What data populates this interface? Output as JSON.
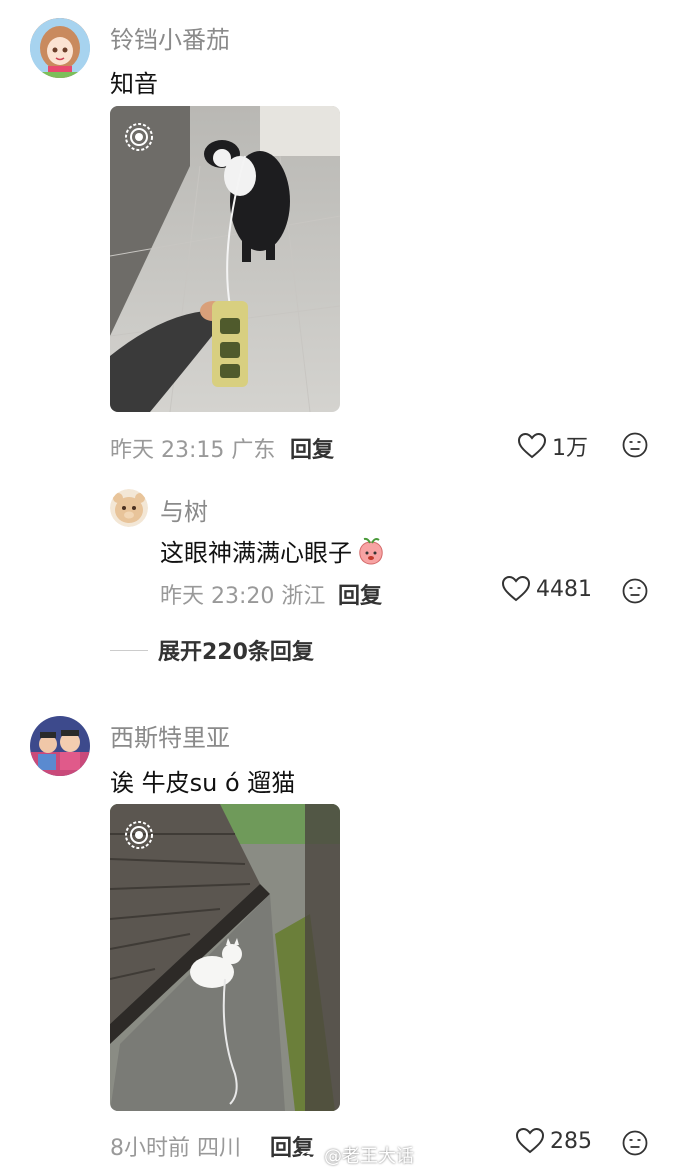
{
  "comments": [
    {
      "username": "铃铛小番茄",
      "text": "知音",
      "time": "昨天 23:15",
      "location": "广东",
      "reply_label": "回复",
      "likes": "1万"
    },
    {
      "username": "西斯特里亚",
      "text": "诶 牛皮su ó 遛猫",
      "time": "8小时前",
      "location": "四川",
      "reply_label": "回复",
      "likes": "285"
    }
  ],
  "reply": {
    "username": "与树",
    "text": "这眼神满满心眼子",
    "time": "昨天 23:20",
    "location": "浙江",
    "reply_label": "回复",
    "likes": "4481"
  },
  "expand_label": "展开220条回复",
  "watermark": "@老王大话",
  "colors": {
    "username": "#8a8a8a",
    "meta": "#999999",
    "text": "#111111"
  },
  "icons": [
    "heart-outline-icon",
    "emoji-face-icon",
    "live-photo-icon",
    "weibo-icon"
  ]
}
